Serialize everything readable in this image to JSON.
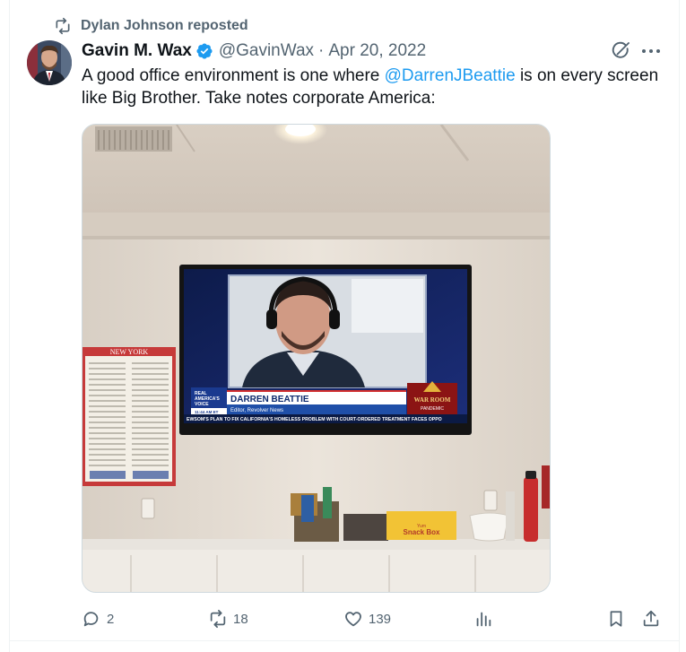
{
  "repost": {
    "text": "Dylan Johnson reposted",
    "icon": "repost-icon"
  },
  "author": {
    "name": "Gavin M. Wax",
    "handle": "@GavinWax",
    "separator": "·",
    "date": "Apr 20, 2022",
    "verified_color": "#1d9bf0"
  },
  "tweet": {
    "text_before": "A good office environment is one where ",
    "mention": "@DarrenJBeattie",
    "text_after": " is on every screen like Big Brother. Take notes corporate America:"
  },
  "media": {
    "tv": {
      "network_label_1": "REAL",
      "network_label_2": "AMERICA'S",
      "network_label_3": "VOICE",
      "time": "11:44 AM ET",
      "name": "DARREN BEATTIE",
      "title": "Editor, Revolver News",
      "ticker": "EWSOM'S PLAN TO FIX CALIFORNIA'S HOMELESS PROBLEM WITH COURT-ORDERED TREATMENT FACES OPPO",
      "show_logo": "WAR ROOM",
      "show_logo_sub": "PANDEMIC"
    },
    "poster_header": "NEW YORK",
    "snack_box": "Snack Box",
    "snack_box_brand": "Yum"
  },
  "actions": {
    "replies": "2",
    "reposts": "18",
    "likes": "139"
  },
  "colors": {
    "accent": "#1d9bf0",
    "muted": "#536471",
    "text": "#0f1419"
  }
}
